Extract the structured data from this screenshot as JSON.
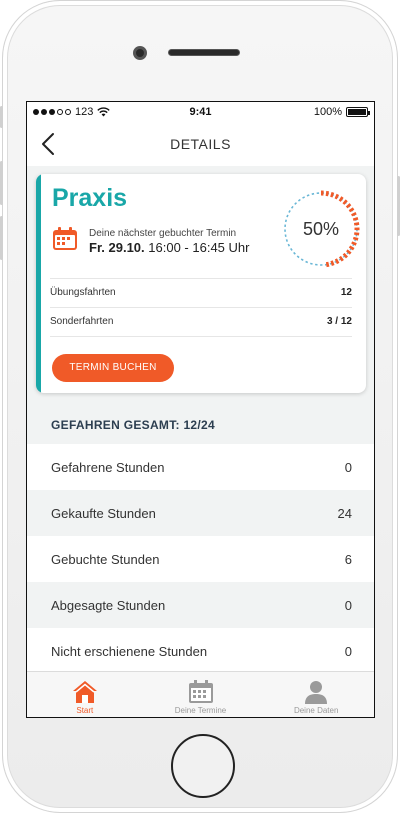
{
  "status_bar": {
    "carrier": "123",
    "time": "9:41",
    "battery": "100%"
  },
  "header": {
    "title": "DETAILS",
    "back_icon": "chevron-left-icon"
  },
  "card": {
    "title": "Praxis",
    "next_label": "Deine nächster gebuchter Termin",
    "next_day": "Fr. 29.10.",
    "next_time": "16:00 - 16:45 Uhr",
    "progress": 0.5,
    "progress_text": "50%",
    "stats": [
      {
        "label": "Übungsfahrten",
        "value": "12"
      },
      {
        "label": "Sonderfahrten",
        "value": "3 / 12"
      }
    ],
    "button_label": "TERMIN BUCHEN"
  },
  "summary": {
    "title": "GEFAHREN GESAMT: 12/24",
    "rows": [
      {
        "label": "Gefahrene Stunden",
        "value": "0"
      },
      {
        "label": "Gekaufte Stunden",
        "value": "24"
      },
      {
        "label": "Gebuchte Stunden",
        "value": "6"
      },
      {
        "label": "Abgesagte Stunden",
        "value": "0"
      },
      {
        "label": "Nicht erschienene Stunden",
        "value": "0"
      }
    ]
  },
  "tabs": [
    {
      "label": "Start",
      "icon": "home-icon",
      "active": true
    },
    {
      "label": "Deine Termine",
      "icon": "calendar-icon",
      "active": false
    },
    {
      "label": "Deine Daten",
      "icon": "user-icon",
      "active": false
    }
  ],
  "colors": {
    "accent_teal": "#19a7a8",
    "accent_orange": "#f05a28",
    "ring_dashed": "#6ab7d6"
  }
}
